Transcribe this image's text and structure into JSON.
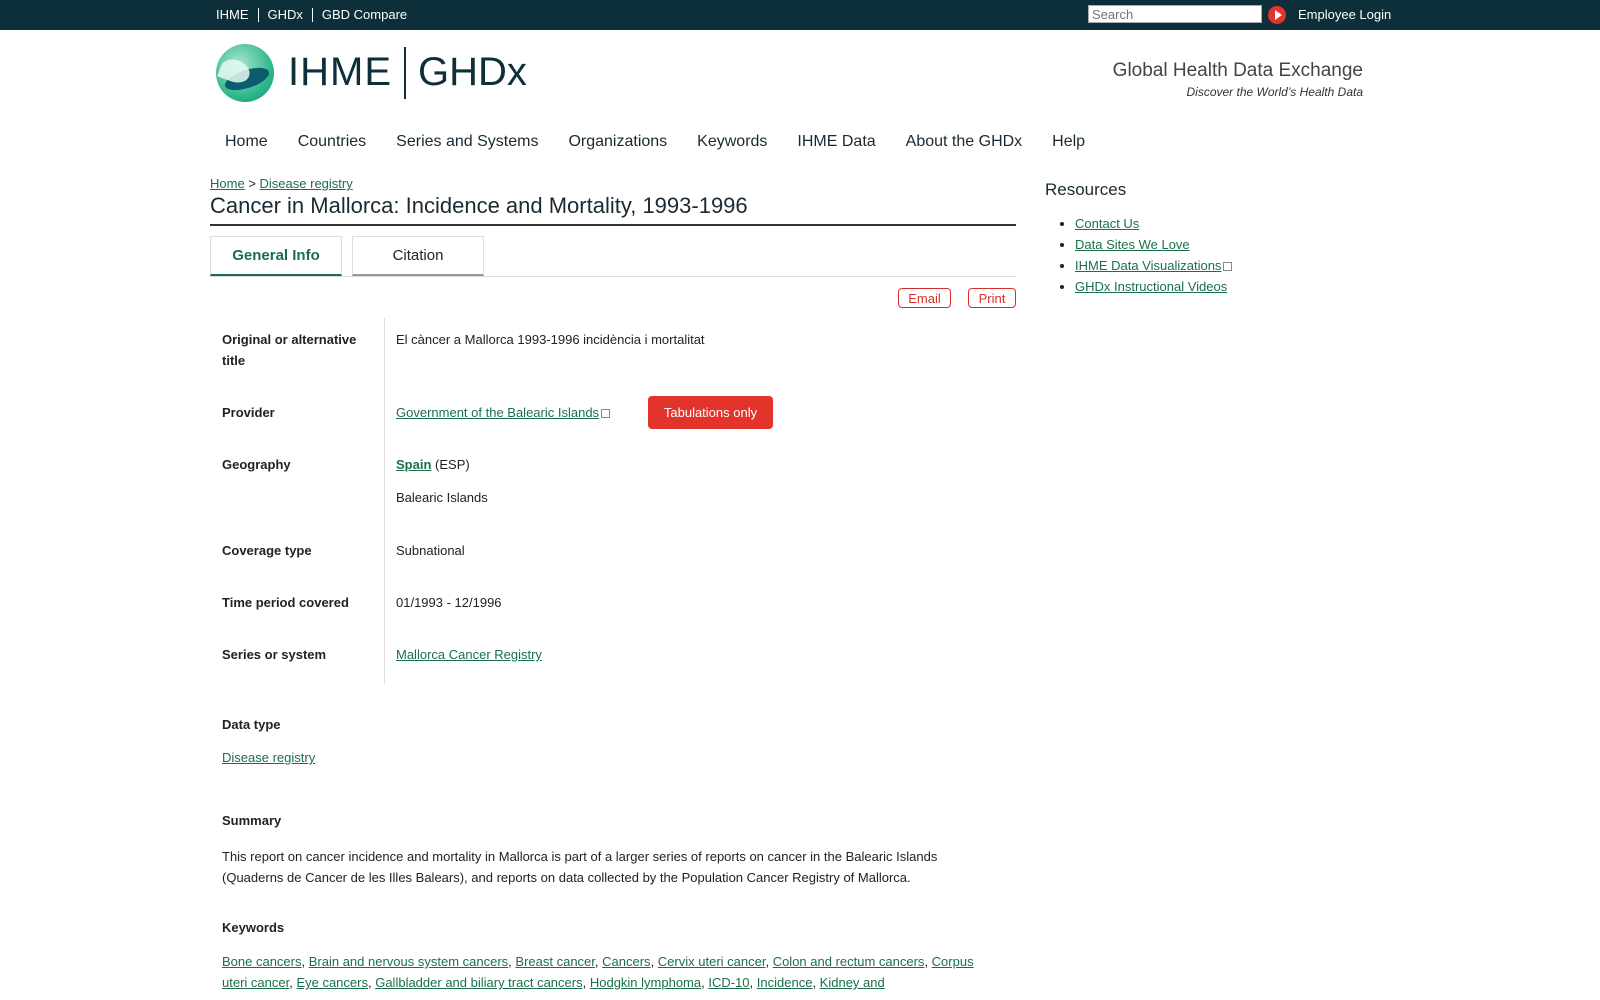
{
  "topbar": {
    "links": [
      "IHME",
      "GHDx",
      "GBD Compare"
    ],
    "search_placeholder": "Search",
    "employee_login": "Employee Login"
  },
  "header": {
    "logo_ihme": "IHME",
    "logo_ghdx": "GHDx",
    "tagline": "Global Health Data Exchange",
    "subtagline": "Discover the World’s Health Data"
  },
  "nav": [
    "Home",
    "Countries",
    "Series and Systems",
    "Organizations",
    "Keywords",
    "IHME Data",
    "About the GHDx",
    "Help"
  ],
  "breadcrumb": {
    "home": "Home",
    "sep": ">",
    "current": "Disease registry"
  },
  "page_title": "Cancer in Mallorca: Incidence and Mortality, 1993-1996",
  "tabs": {
    "general": "General Info",
    "citation": "Citation"
  },
  "actions": {
    "email": "Email",
    "print": "Print"
  },
  "info": {
    "alt_title_label": "Original or alternative title",
    "alt_title_value": "El càncer a Mallorca 1993-1996 incidència i mortalitat",
    "provider_label": "Provider",
    "provider_value": "Government of the Balearic Islands",
    "provider_badge": "Tabulations only",
    "geography_label": "Geography",
    "geography_country": "Spain",
    "geography_code": "(ESP)",
    "geography_region": "Balearic Islands",
    "coverage_label": "Coverage type",
    "coverage_value": "Subnational",
    "time_label": "Time period covered",
    "time_value": "01/1993 - 12/1996",
    "series_label": "Series or system",
    "series_value": "Mallorca Cancer Registry"
  },
  "data_type": {
    "label": "Data type",
    "value": "Disease registry"
  },
  "summary": {
    "label": "Summary",
    "text": "This report on cancer incidence and mortality in Mallorca is part of a larger series of reports on cancer in the Balearic Islands (Quaderns de Cancer de les Illes Balears), and reports on data collected by the Population Cancer Registry of Mallorca."
  },
  "keywords": {
    "label": "Keywords",
    "items": [
      "Bone cancers",
      "Brain and nervous system cancers",
      "Breast cancer",
      "Cancers",
      "Cervix uteri cancer",
      "Colon and rectum cancers",
      "Corpus uteri cancer",
      "Eye cancers",
      "Gallbladder and biliary tract cancers",
      "Hodgkin lymphoma",
      "ICD-10",
      "Incidence",
      "Kidney and"
    ]
  },
  "resources": {
    "title": "Resources",
    "items": [
      "Contact Us",
      "Data Sites We Love",
      "IHME Data Visualizations",
      "GHDx Instructional Videos"
    ]
  }
}
